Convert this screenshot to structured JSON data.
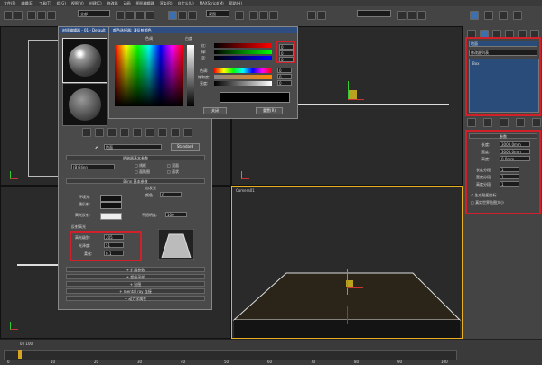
{
  "menu": [
    "文件(F)",
    "编辑(E)",
    "工具(T)",
    "组(G)",
    "视图(V)",
    "创建(C)",
    "修改器",
    "动画",
    "图形编辑器",
    "渲染(R)",
    "自定义(U)",
    "MAXScript(M)",
    "帮助(H)"
  ],
  "toolbar": {
    "selection_filter": "全部",
    "coord_system": "视图"
  },
  "viewports": {
    "top_label": "",
    "front_label": "",
    "left_label": "",
    "persp_label": "Camera01"
  },
  "material_editor": {
    "title": "材质编辑器 - 01 - Default",
    "material_name": "地面",
    "material_type": "Standard",
    "rollout_shader": "明暗器基本参数",
    "shader_type": "(B)Blinn",
    "opt_wire": "线框",
    "opt_2sided": "双面",
    "opt_facemap": "面贴图",
    "opt_faceted": "面状",
    "rollout_blinn": "Blinn 基本参数",
    "self_illum": "自发光",
    "self_color": "颜色",
    "self_color_val": "0",
    "ambient": "环境光:",
    "diffuse": "漫反射:",
    "specular": "高光反射:",
    "opacity": "不透明度:",
    "opacity_val": "100",
    "spec_group": "反射高光",
    "spec_level": "高光级别:",
    "spec_level_val": "205",
    "gloss": "光泽度:",
    "gloss_val": "51",
    "soften": "柔化:",
    "soften_val": "0.1",
    "rollouts": [
      "扩展参数",
      "超级采样",
      "贴图",
      "mental ray 连接",
      "动力学属性"
    ]
  },
  "color_selector": {
    "title": "颜色选择器: 漫反射颜色",
    "hue": "色调",
    "white": "白度",
    "blackness": "黑",
    "red": "红:",
    "green": "绿:",
    "blue": "蓝:",
    "hue_lbl": "色调:",
    "sat": "饱和度:",
    "val": "亮度:",
    "red_val": "0",
    "green_val": "0",
    "blue_val": "0",
    "hue_val": "0",
    "sat_val": "0",
    "val_val": "0",
    "close": "关闭",
    "reset": "重置(R)"
  },
  "right_panel": {
    "object_name": "地面",
    "modifier_list": "修改器列表",
    "stack_item": "Box",
    "params": "参数",
    "length": "长度:",
    "length_val": "3000.0mm",
    "width": "宽度:",
    "width_val": "3000.0mm",
    "height": "高度:",
    "height_val": "0.0mm",
    "len_seg": "长度分段:",
    "len_seg_val": "1",
    "wid_seg": "宽度分段:",
    "wid_seg_val": "1",
    "hgt_seg": "高度分段:",
    "hgt_seg_val": "1",
    "gen_map": "生成贴图坐标",
    "real_world": "真实世界贴图大小"
  },
  "timeline": {
    "frame": "0 / 100",
    "ticks": [
      "0",
      "10",
      "20",
      "30",
      "40",
      "50",
      "60",
      "70",
      "80",
      "90",
      "100"
    ]
  }
}
